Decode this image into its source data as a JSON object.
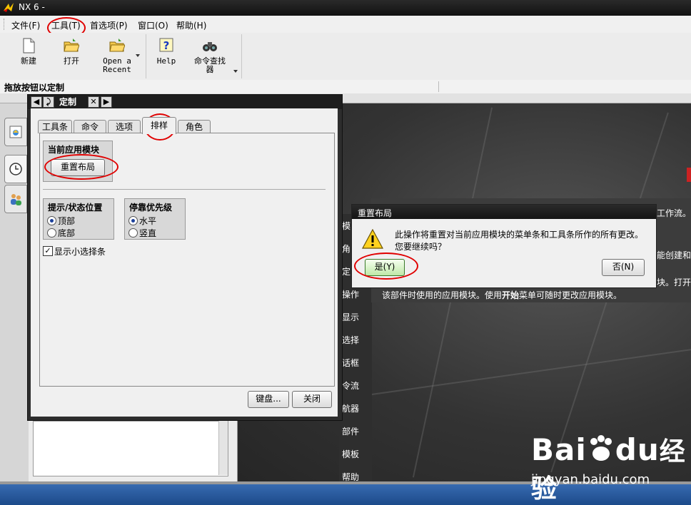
{
  "window": {
    "title": "NX 6 -"
  },
  "menu": {
    "items": [
      "文件(F)",
      "工具(T)",
      "首选项(P)",
      "窗口(O)",
      "帮助(H)"
    ]
  },
  "toolbar": {
    "new_label": "新建",
    "open_label": "打开",
    "open_recent_label_1": "Open a",
    "open_recent_label_2": "Recent",
    "help_label": "Help",
    "cmd_finder_label_1": "命令查找",
    "cmd_finder_label_2": "器"
  },
  "status": {
    "hint": "拖放按钮以定制"
  },
  "customize": {
    "title": "定制",
    "tabs": [
      "工具条",
      "命令",
      "选项",
      "排样",
      "角色"
    ],
    "active_tab": "排样",
    "current_module_title": "当前应用模块",
    "reset_button": "重置布局",
    "prompt_status_title": "提示/状态位置",
    "prompt_top": "顶部",
    "prompt_bottom": "底部",
    "dock_title": "停靠优先级",
    "dock_horizontal": "水平",
    "dock_vertical": "竖直",
    "show_mini_bar": "显示小选择条",
    "keyboard_button": "键盘...",
    "close_button": "关闭"
  },
  "confirm": {
    "title": "重置布局",
    "message_line1": "此操作将重置对当前应用模块的菜单条和工具条所作的所有更改。",
    "message_line2": "您要继续吗？",
    "yes_button": "是(Y)",
    "no_button": "否(N)"
  },
  "background": {
    "left_column": [
      "模",
      "角",
      "定",
      "操作",
      "显示",
      "选择",
      "话框",
      "令流",
      "航器",
      "部件",
      "模板",
      "帮助"
    ],
    "text_right_1": "可工作流。",
    "text_right_2": "您能创建和",
    "text_right_3": "模块。打开",
    "text_line_a": "该部件时使用的应用模块。使用",
    "text_line_bold": "开始",
    "text_line_b": "菜单可随时更改应用模块。"
  },
  "watermark": {
    "brand": "Bai",
    "brand2": "du",
    "cn": "经验",
    "url": "jingyan.baidu.com"
  },
  "colors": {
    "annotation": "#e00000",
    "dark_bg": "#333333",
    "taskbar": "#2a5ca0"
  }
}
